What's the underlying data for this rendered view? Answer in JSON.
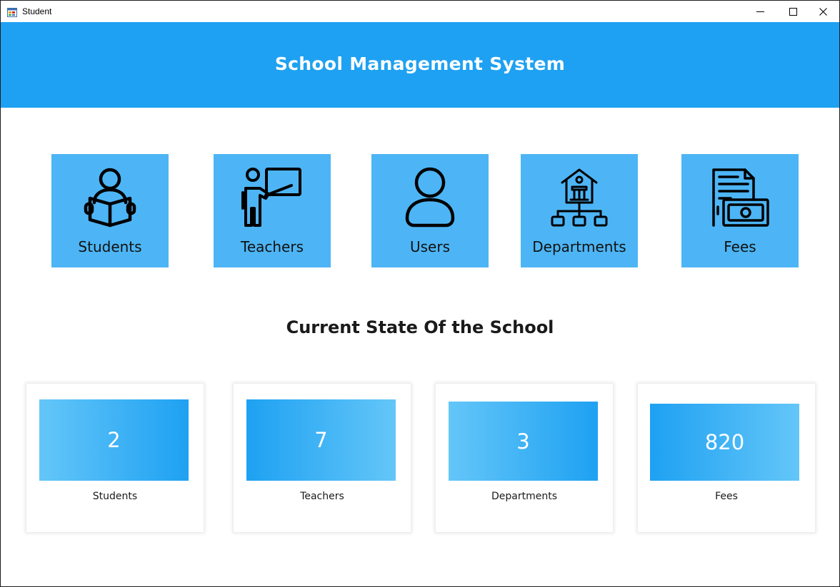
{
  "window": {
    "title": "Student",
    "icon": "app-form-icon",
    "controls": [
      "minimize-icon",
      "maximize-icon",
      "close-icon"
    ]
  },
  "header": {
    "title": "School Management System",
    "background": "#1ea1f2"
  },
  "nav": {
    "tile_color": "#4db5f5",
    "tiles": [
      {
        "label": "Students",
        "icon": "student-reading-icon"
      },
      {
        "label": "Teachers",
        "icon": "teacher-board-icon"
      },
      {
        "label": "Users",
        "icon": "user-icon"
      },
      {
        "label": "Departments",
        "icon": "department-building-icon"
      },
      {
        "label": "Fees",
        "icon": "fees-money-icon"
      }
    ]
  },
  "stats": {
    "title": "Current State Of the School",
    "cards": [
      {
        "value": "2",
        "label": "Students"
      },
      {
        "value": "7",
        "label": "Teachers"
      },
      {
        "value": "3",
        "label": "Departments"
      },
      {
        "value": "820",
        "label": "Fees"
      }
    ],
    "gradient_light": "#64c6f8",
    "gradient_dark": "#1ea1f2"
  }
}
